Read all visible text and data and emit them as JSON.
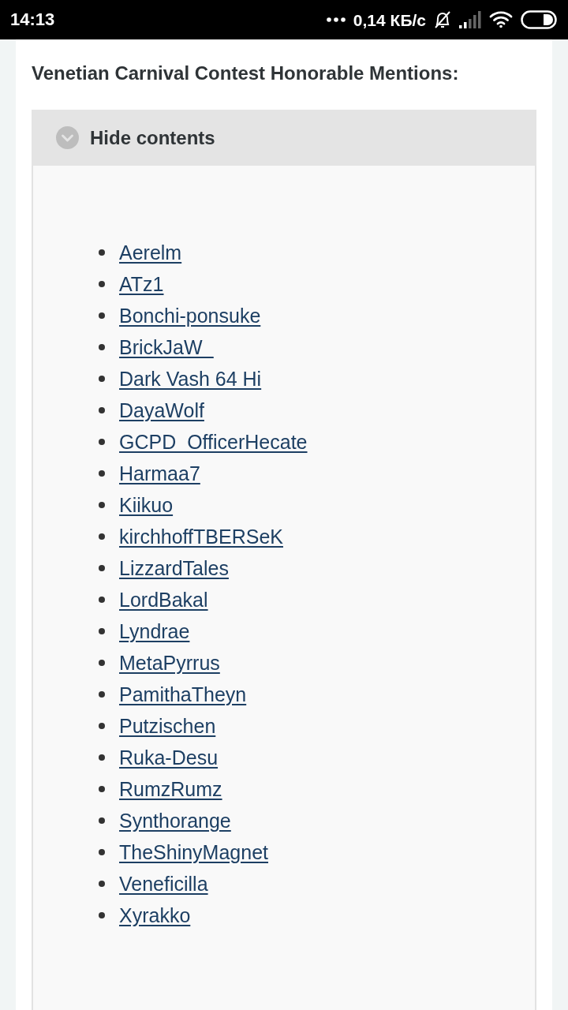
{
  "status_bar": {
    "time": "14:13",
    "network_speed": "0,14 КБ/с"
  },
  "heading": "Venetian Carnival Contest Honorable Mentions:",
  "spoiler": {
    "toggle_label": "Hide contents",
    "expanded": true,
    "links": [
      "Aerelm",
      "ATz1",
      "Bonchi-ponsuke",
      "BrickJaW_",
      "Dark Vash 64 Hi",
      "DayaWolf",
      "GCPD_OfficerHecate",
      "Harmaa7",
      "Kiikuo",
      "kirchhoffTBERSeK",
      "LizzardTales",
      "LordBakal",
      "Lyndrae",
      "MetaPyrrus",
      "PamithaTheyn",
      "Putzischen",
      "Ruka-Desu",
      "RumzRumz",
      "Synthorange",
      "TheShinyMagnet",
      "Veneficilla",
      "Xyrakko"
    ]
  }
}
